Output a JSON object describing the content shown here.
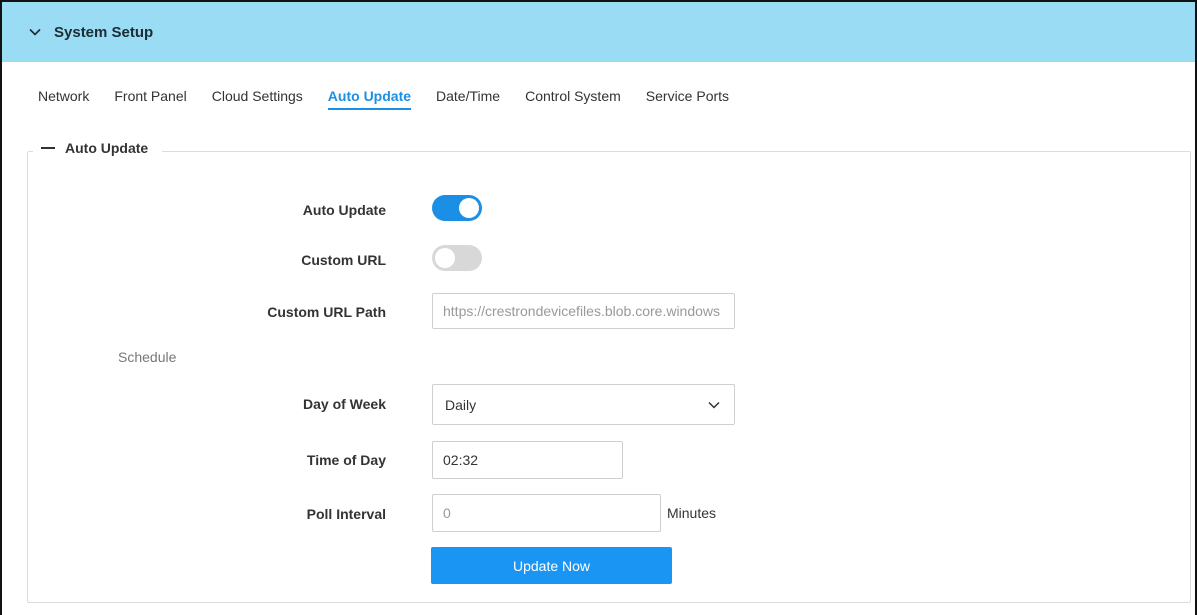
{
  "section": {
    "title": "System Setup",
    "icon": "chevron-down-icon"
  },
  "tabs": [
    {
      "label": "Network",
      "active": false
    },
    {
      "label": "Front Panel",
      "active": false
    },
    {
      "label": "Cloud Settings",
      "active": false
    },
    {
      "label": "Auto Update",
      "active": true
    },
    {
      "label": "Date/Time",
      "active": false
    },
    {
      "label": "Control System",
      "active": false
    },
    {
      "label": "Service Ports",
      "active": false
    }
  ],
  "panel": {
    "legend": "Auto Update",
    "legend_icon": "minus-icon",
    "auto_update": {
      "label": "Auto Update",
      "enabled": true
    },
    "custom_url": {
      "label": "Custom URL",
      "enabled": false
    },
    "custom_url_path": {
      "label": "Custom URL Path",
      "value": "https://crestrondevicefiles.blob.core.windows"
    },
    "schedule_label": "Schedule",
    "day_of_week": {
      "label": "Day of Week",
      "value": "Daily",
      "icon": "chevron-down-icon"
    },
    "time_of_day": {
      "label": "Time of Day",
      "value": "02:32"
    },
    "poll_interval": {
      "label": "Poll Interval",
      "value": "0",
      "unit": "Minutes"
    },
    "update_button": "Update Now"
  },
  "colors": {
    "header_bg": "#99dcf4",
    "accent": "#1b8fe6",
    "button": "#1b95f3"
  }
}
